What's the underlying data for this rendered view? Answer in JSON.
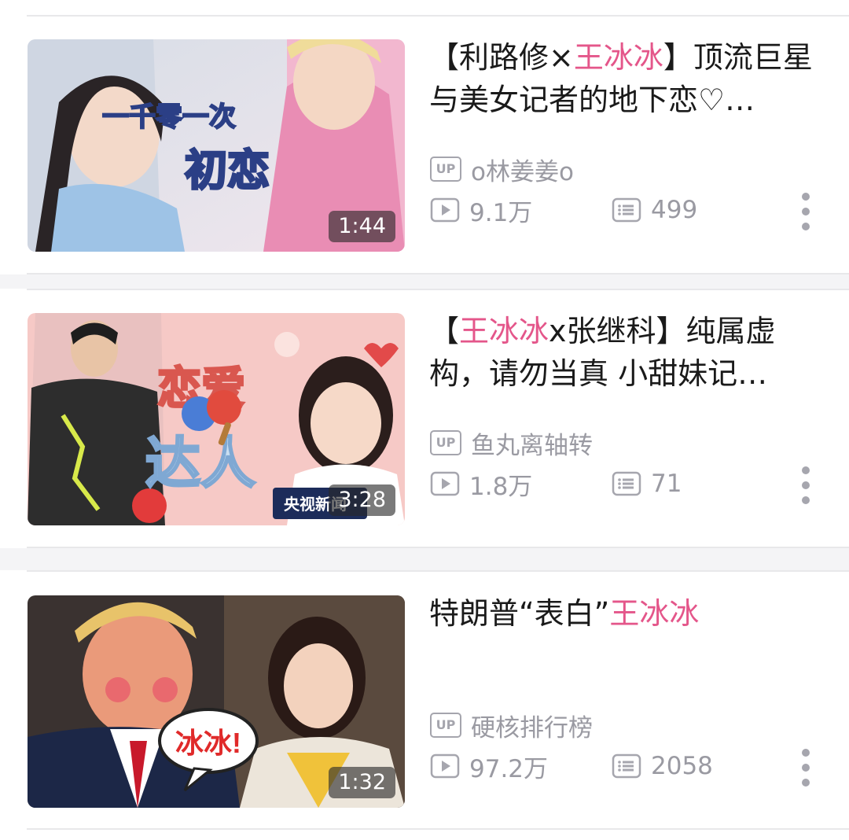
{
  "videos": [
    {
      "title_prefix": "【利路修",
      "title_sep": "×",
      "title_hl": "王冰冰",
      "title_rest": "】顶流巨星与美女记者的地下恋♡…",
      "thumb_text_1": "一千零一次",
      "thumb_text_2": "初恋",
      "duration": "1:44",
      "up_badge": "UP",
      "uploader": "o林姜姜o",
      "views": "9.1万",
      "danmaku": "499"
    },
    {
      "title_prefix": "【",
      "title_sep": "",
      "title_hl": "王冰冰",
      "title_rest": "x张继科】纯属虚构，请勿当真 小甜妹记…",
      "thumb_text_1": "恋爱",
      "thumb_text_2": "达人",
      "thumb_text_3": "央视新闻",
      "duration": "3:28",
      "up_badge": "UP",
      "uploader": "鱼丸离轴转",
      "views": "1.8万",
      "danmaku": "71"
    },
    {
      "title_prefix": "特朗普“表白”",
      "title_sep": "",
      "title_hl": "王冰冰",
      "title_rest": "",
      "thumb_text_1": "冰冰!",
      "duration": "1:32",
      "up_badge": "UP",
      "uploader": "硬核排行榜",
      "views": "97.2万",
      "danmaku": "2058"
    }
  ],
  "colors": {
    "highlight": "#e4568a",
    "meta_gray": "#9a9aa2",
    "title": "#1a1a1a"
  },
  "icons": [
    "up-badge-icon",
    "play-count-icon",
    "danmaku-icon",
    "more-icon"
  ]
}
